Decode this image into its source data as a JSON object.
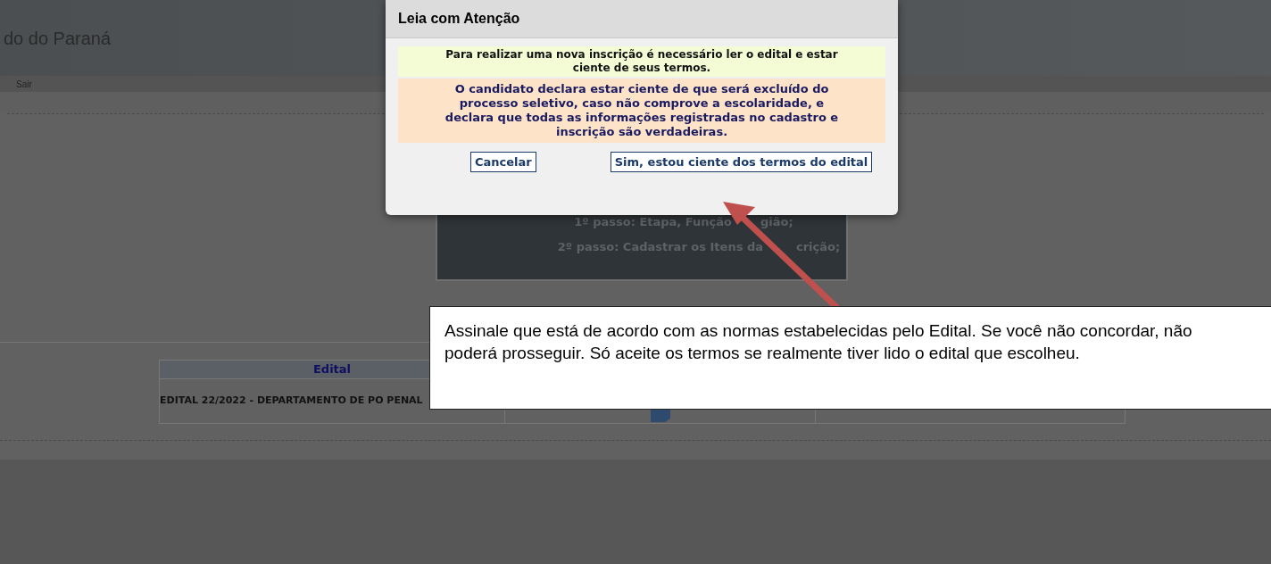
{
  "header": {
    "title": "do do Paraná"
  },
  "menu": {
    "items": [
      "Sair"
    ]
  },
  "steps_box": {
    "lines": [
      {
        "parts": [
          "1º passo: Etapa, Função",
          "gião;"
        ]
      },
      {
        "parts": [
          "2º passo: Cadastrar os Itens da",
          "crição;"
        ]
      }
    ]
  },
  "table": {
    "columns": [
      "Edital"
    ],
    "rows": [
      {
        "column_1": "EDITAL 22/2022 - DEPARTAMENTO DE PO PENAL"
      }
    ]
  },
  "dialog": {
    "title": "Leia com Atenção",
    "notice": "Para realizar uma nova inscrição é necessário ler o edital e estar ciente de seus termos.",
    "declaration": "O candidato declara estar ciente de que será excluído do processo seletivo, caso não comprove a escolaridade, e declara que todas as informações registradas no cadastro e inscrição são verdadeiras.",
    "buttons": [
      "Cancelar",
      "Sim, estou ciente dos termos do edital"
    ]
  },
  "callout": {
    "text": "Assinale que está de acordo com as normas estabelecidas pelo Edital. Se você não concordar, não poderá prosseguir. Só aceite os termos se realmente tiver lido o edital que escolheu."
  }
}
